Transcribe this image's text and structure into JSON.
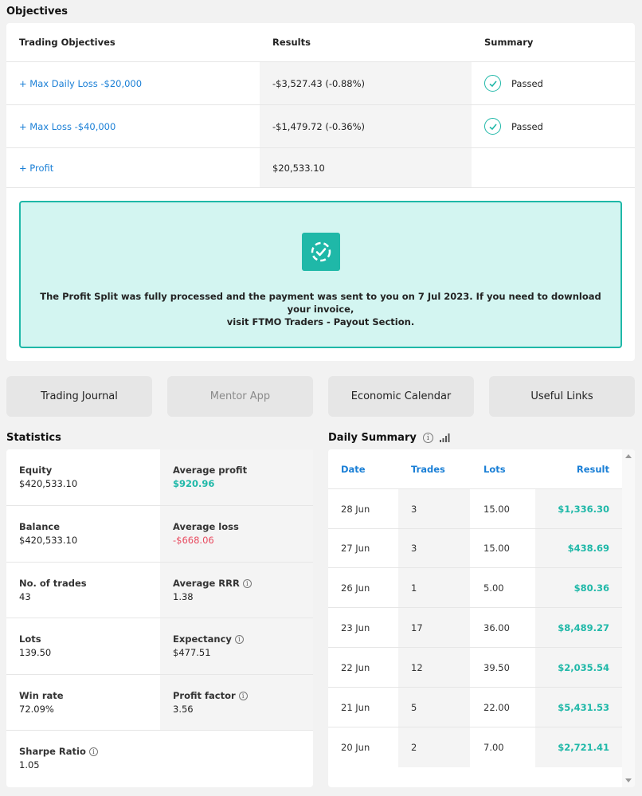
{
  "objectives": {
    "title": "Objectives",
    "headers": [
      "Trading Objectives",
      "Results",
      "Summary"
    ],
    "rows": [
      {
        "objective": "+ Max Daily Loss -$20,000",
        "result": "-$3,527.43 (-0.88%)",
        "summary": "Passed"
      },
      {
        "objective": "+ Max Loss -$40,000",
        "result": "-$1,479.72 (-0.36%)",
        "summary": "Passed"
      },
      {
        "objective": "+ Profit",
        "result": "$20,533.10",
        "summary": ""
      }
    ],
    "notice": {
      "line1": "The Profit Split was fully processed and the payment was sent to you on 7 Jul 2023. If you need to download your invoice,",
      "line2": "visit FTMO Traders - Payout Section."
    }
  },
  "buttons": {
    "trading_journal": "Trading Journal",
    "mentor_app": "Mentor App",
    "economic_calendar": "Economic Calendar",
    "useful_links": "Useful Links"
  },
  "statistics": {
    "title": "Statistics",
    "rows": [
      {
        "left": {
          "label": "Equity",
          "value": "$420,533.10"
        },
        "right": {
          "label": "Average profit",
          "value": "$920.96"
        }
      },
      {
        "left": {
          "label": "Balance",
          "value": "$420,533.10"
        },
        "right": {
          "label": "Average loss",
          "value": "-$668.06"
        }
      },
      {
        "left": {
          "label": "No. of trades",
          "value": "43"
        },
        "right": {
          "label": "Average RRR",
          "value": "1.38"
        }
      },
      {
        "left": {
          "label": "Lots",
          "value": "139.50"
        },
        "right": {
          "label": "Expectancy",
          "value": "$477.51"
        }
      },
      {
        "left": {
          "label": "Win rate",
          "value": "72.09%"
        },
        "right": {
          "label": "Profit factor",
          "value": "3.56"
        }
      },
      {
        "left": {
          "label": "Sharpe Ratio",
          "value": "1.05"
        }
      }
    ]
  },
  "daily_summary": {
    "title": "Daily Summary",
    "headers": [
      "Date",
      "Trades",
      "Lots",
      "Result"
    ],
    "rows": [
      [
        "28 Jun",
        "3",
        "15.00",
        "$1,336.30"
      ],
      [
        "27 Jun",
        "3",
        "15.00",
        "$438.69"
      ],
      [
        "26 Jun",
        "1",
        "5.00",
        "$80.36"
      ],
      [
        "23 Jun",
        "17",
        "36.00",
        "$8,489.27"
      ],
      [
        "22 Jun",
        "12",
        "39.50",
        "$2,035.54"
      ],
      [
        "21 Jun",
        "5",
        "22.00",
        "$5,431.53"
      ],
      [
        "20 Jun",
        "2",
        "7.00",
        "$2,721.41"
      ]
    ]
  },
  "colors": {
    "accent": "#1fb8a8",
    "link": "#1a7fd6",
    "negative": "#e84a5f"
  }
}
